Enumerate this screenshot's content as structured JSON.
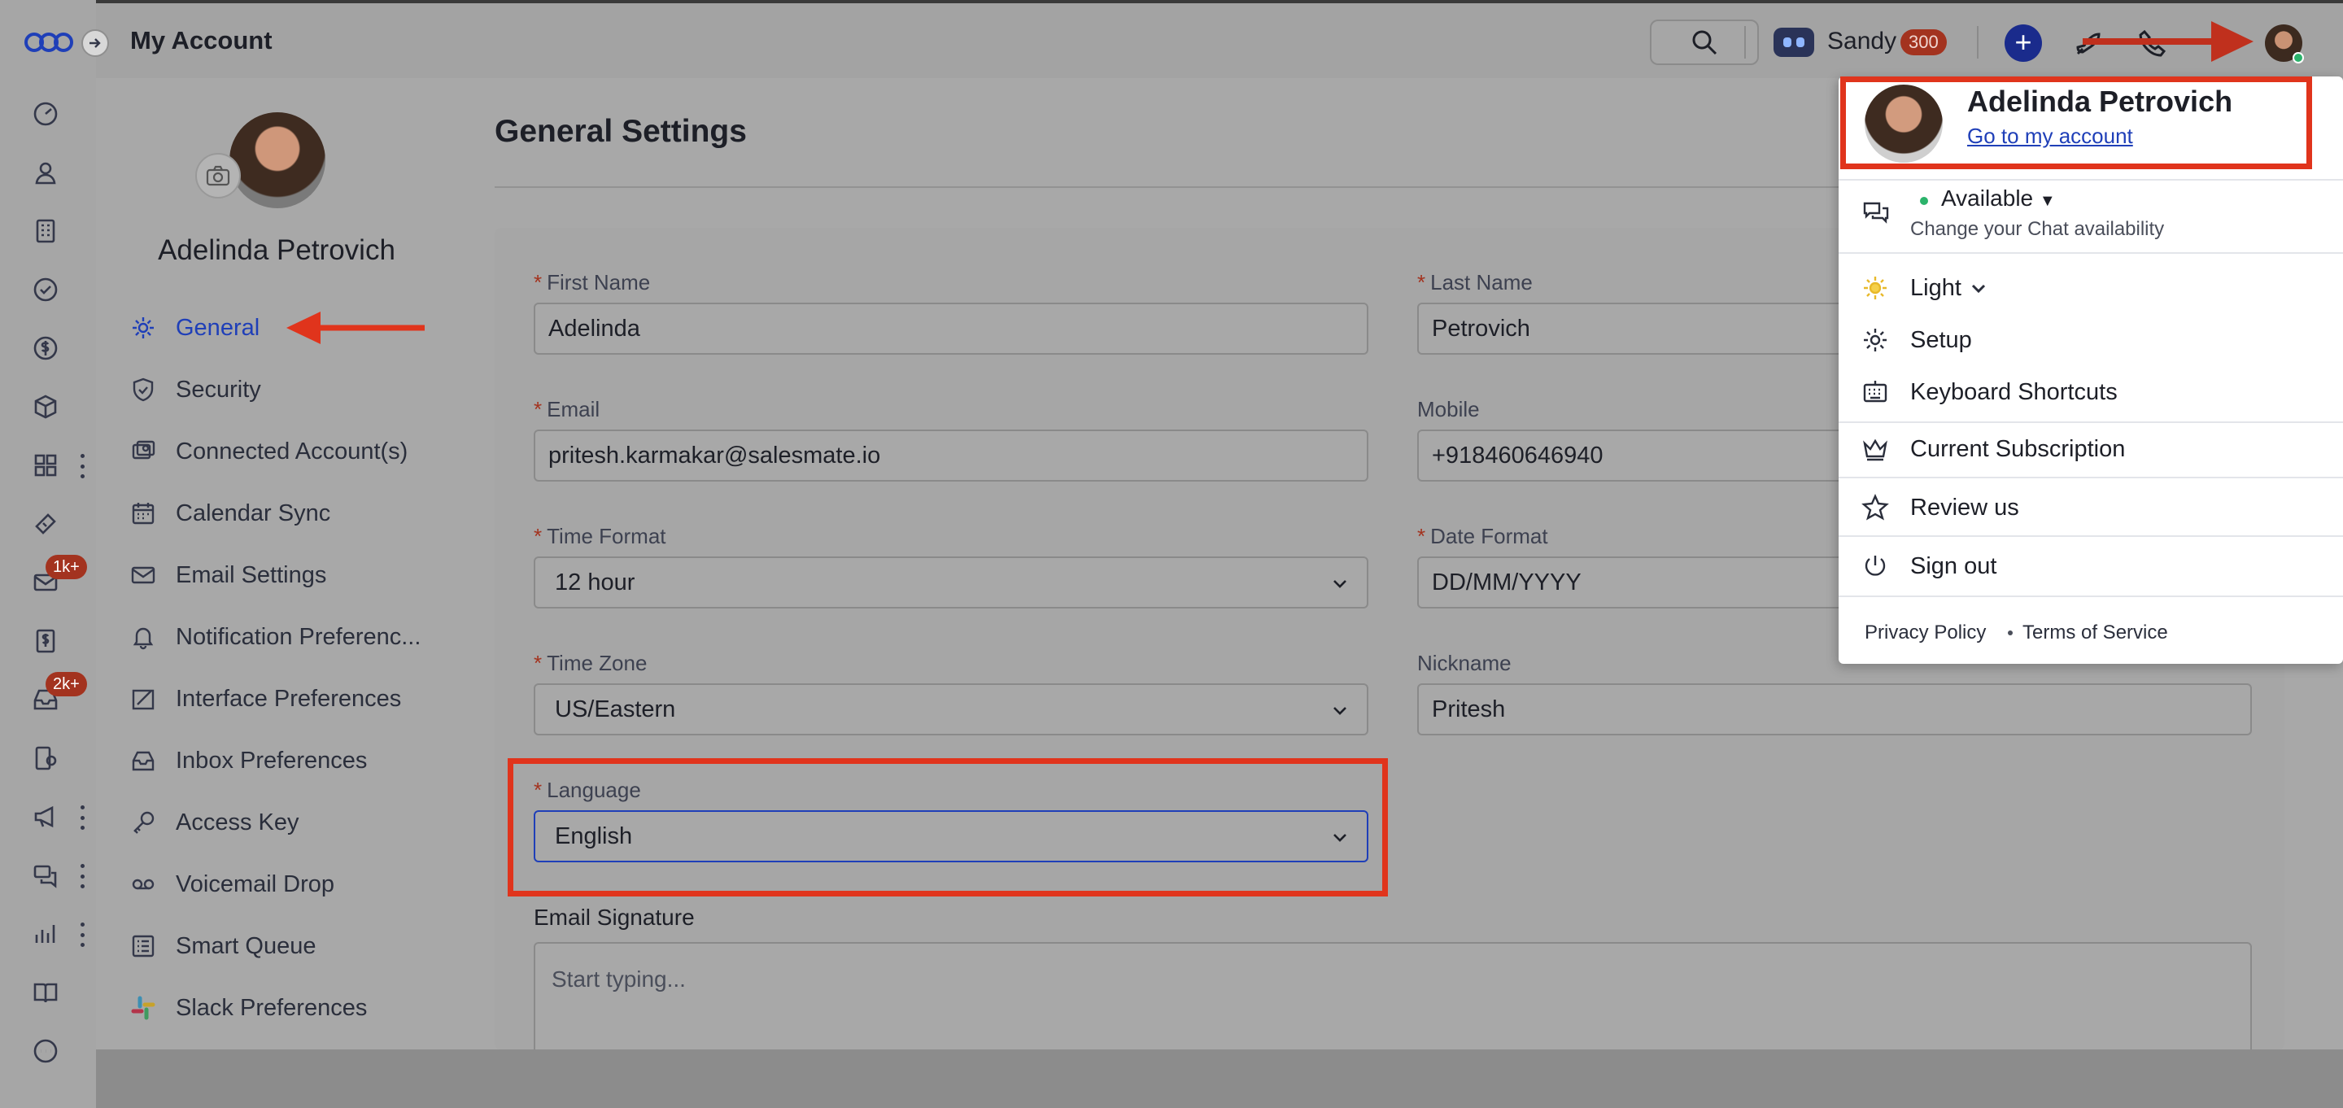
{
  "window": {
    "title": "My Account"
  },
  "header": {
    "user_name": "Sandy",
    "credits": "300",
    "plus_label": "+"
  },
  "rail": {
    "badges": {
      "email": "1k+",
      "inbox": "2k+"
    },
    "items": [
      "dashboard-icon",
      "contacts-icon",
      "companies-icon",
      "tasks-icon",
      "deals-icon",
      "products-icon",
      "apps-icon",
      "tickets-icon",
      "email-icon",
      "invoices-icon",
      "inbox-icon",
      "sequences-icon",
      "campaigns-icon",
      "conversations-icon",
      "reports-icon",
      "knowledge-base-icon",
      "more-icon"
    ]
  },
  "profile": {
    "name": "Adelinda Petrovich"
  },
  "nav": {
    "items": [
      {
        "label": "General",
        "icon": "gear-icon",
        "active": true
      },
      {
        "label": "Security",
        "icon": "shield-icon"
      },
      {
        "label": "Connected Account(s)",
        "icon": "connected-accounts-icon"
      },
      {
        "label": "Calendar Sync",
        "icon": "calendar-icon"
      },
      {
        "label": "Email Settings",
        "icon": "mail-icon"
      },
      {
        "label": "Notification Preferenc...",
        "icon": "bell-icon"
      },
      {
        "label": "Interface Preferences",
        "icon": "interface-icon"
      },
      {
        "label": "Inbox Preferences",
        "icon": "inbox-icon"
      },
      {
        "label": "Access Key",
        "icon": "key-icon"
      },
      {
        "label": "Voicemail Drop",
        "icon": "voicemail-icon"
      },
      {
        "label": "Smart Queue",
        "icon": "queue-icon"
      },
      {
        "label": "Slack Preferences",
        "icon": "slack-icon"
      }
    ]
  },
  "general": {
    "title": "General Settings",
    "required_mark": "*",
    "first_name": {
      "label": "First Name",
      "value": "Adelinda"
    },
    "last_name": {
      "label": "Last Name",
      "value": "Petrovich"
    },
    "email": {
      "label": "Email",
      "value": "pritesh.karmakar@salesmate.io"
    },
    "mobile": {
      "label": "Mobile",
      "value": "+918460646940"
    },
    "time_format": {
      "label": "Time Format",
      "value": "12 hour"
    },
    "date_format": {
      "label": "Date Format",
      "value": "DD/MM/YYYY"
    },
    "time_zone": {
      "label": "Time Zone",
      "value": "US/Eastern"
    },
    "nickname": {
      "label": "Nickname",
      "value": "Pritesh"
    },
    "language": {
      "label": "Language",
      "value": "English"
    },
    "signature": {
      "label": "Email Signature",
      "placeholder": "Start typing..."
    }
  },
  "menu": {
    "name": "Adelinda Petrovich",
    "account_link": "Go to my account",
    "availability": "Available",
    "availability_sub": "Change your Chat availability",
    "theme": "Light",
    "setup": "Setup",
    "shortcuts": "Keyboard Shortcuts",
    "subscription": "Current Subscription",
    "review": "Review us",
    "sign_out": "Sign out",
    "privacy": "Privacy Policy",
    "terms": "Terms of Service"
  },
  "colors": {
    "accent": "#1f3fb8",
    "annotation_red": "#e0341c",
    "badge_red": "#a3331f",
    "status_green": "#2bb36b"
  }
}
